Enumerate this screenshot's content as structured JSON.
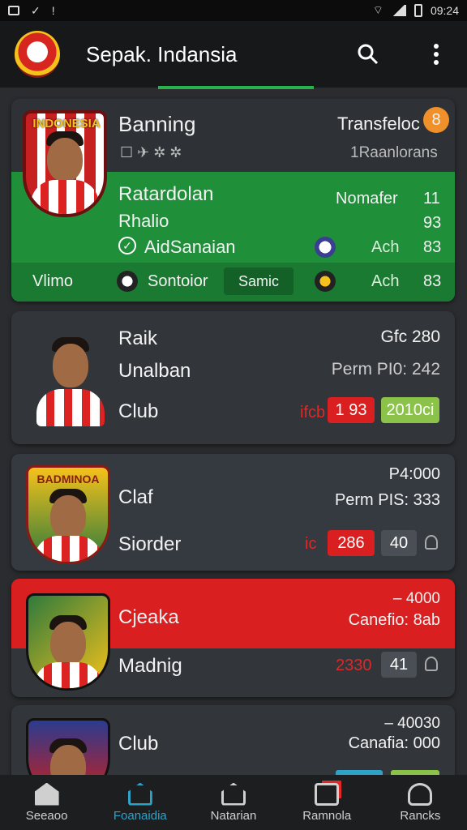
{
  "status_bar": {
    "time": "09:24"
  },
  "app_bar": {
    "title": "Sepak. Indansia"
  },
  "cards": [
    {
      "crest_text": "INDONESIA",
      "name": "Banning",
      "meta_icons": "☐ ✈ ✲ ✲",
      "transfer_label": "Transfeloc",
      "transfer_badge": "8",
      "sub_right": "1Raanlorans",
      "green_rows": [
        {
          "left": "Ratardolan",
          "right_label": "Nomafer",
          "right_value": "11"
        },
        {
          "left": "Rhalio",
          "right_value": "93"
        },
        {
          "left": "AidSanaian",
          "right_label": "Ach",
          "right_value": "83"
        }
      ],
      "footer_left": "Vlimo",
      "footer_mid": "Sontoior",
      "footer_button": "Samic",
      "footer_right_label": "Ach",
      "footer_right_value": "83"
    },
    {
      "line1": "Raik",
      "line1_right": "Gfc 280",
      "line2": "Unalban",
      "line2_right": "Perm PI0: 242",
      "line3": "Club",
      "tag": "ifcb",
      "pill_red": "1 93",
      "pill_green": "2010ci"
    },
    {
      "crest_text": "BADMINOA",
      "line1": "Claf",
      "line1_right": "P4:000",
      "line1_right2": "Perm PIS: 333",
      "line2": "Siorder",
      "tag": "ic",
      "pill_red": "286",
      "pill_dark": "40"
    },
    {
      "line1": "Cjeaka",
      "line1_right_top": "– 4000",
      "line1_right": "Canefio: 8ab",
      "line2": "Madnig",
      "tag": "2330",
      "pill_dark": "41"
    },
    {
      "line1": "Club",
      "line1_right_top": "– 40030",
      "line1_right": "Canafia: 000"
    }
  ],
  "bottom_nav": [
    {
      "label": "Seeaoo"
    },
    {
      "label": "Foanaidia"
    },
    {
      "label": "Natarian"
    },
    {
      "label": "Ramnola"
    },
    {
      "label": "Rancks"
    }
  ],
  "colors": {
    "green": "#1f8f3a",
    "red": "#d91f1f",
    "tab_active": "#2fa2c8",
    "lime": "#8bc34a"
  }
}
